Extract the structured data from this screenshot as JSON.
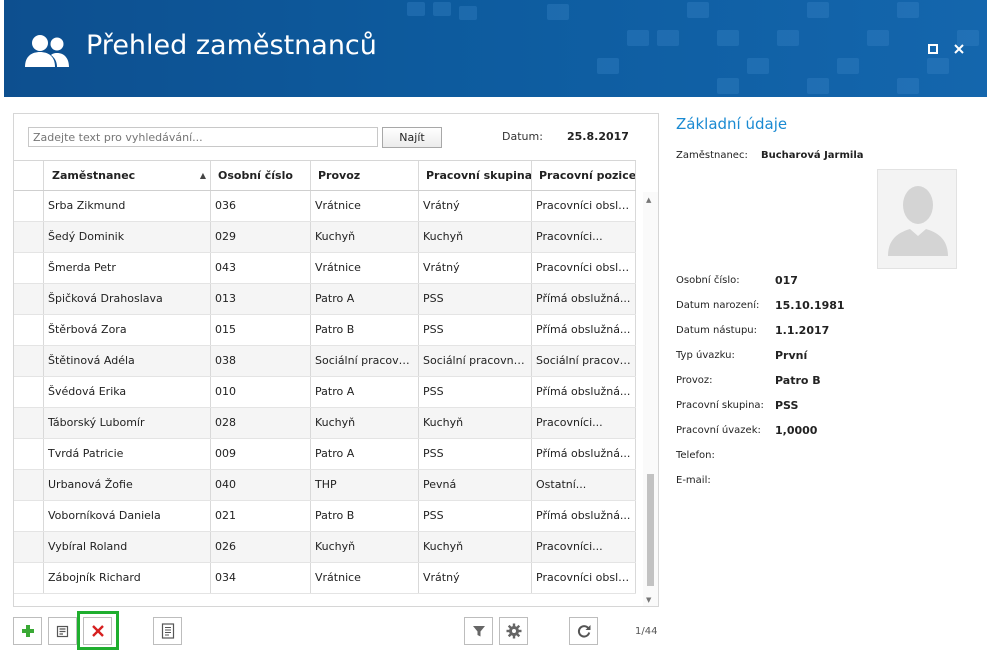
{
  "window": {
    "title": "Přehled zaměstnanců",
    "header_icon": "users-icon",
    "controls": [
      "maximize-icon",
      "close-icon"
    ]
  },
  "search": {
    "placeholder": "Zadejte text pro vyhledávání...",
    "value": "",
    "button_label": "Najít",
    "date_label": "Datum:",
    "date_value": "25.8.2017"
  },
  "grid": {
    "columns": [
      "Zaměstnanec",
      "Osobní číslo",
      "Provoz",
      "Pracovní skupina",
      "Pracovní pozice"
    ],
    "sorted_column": "Zaměstnanec",
    "sort_direction": "ascending",
    "rows": [
      [
        "Srba Zikmund",
        "036",
        "Vrátnice",
        "Vrátný",
        "Pracovníci obsluž..."
      ],
      [
        "Šedý Dominik",
        "029",
        "Kuchyň",
        "Kuchyň",
        "Pracovníci..."
      ],
      [
        "Šmerda Petr",
        "043",
        "Vrátnice",
        "Vrátný",
        "Pracovníci obsluž..."
      ],
      [
        "Špičková Drahoslava",
        "013",
        "Patro A",
        "PSS",
        "Přímá obslužná..."
      ],
      [
        "Štěrbová Zora",
        "015",
        "Patro B",
        "PSS",
        "Přímá obslužná..."
      ],
      [
        "Štětinová Adéla",
        "038",
        "Sociální pracovníci",
        "Sociální pracovnice ...",
        "Sociální pracovníci"
      ],
      [
        "Švédová Erika",
        "010",
        "Patro A",
        "PSS",
        "Přímá obslužná..."
      ],
      [
        "Táborský Lubomír",
        "028",
        "Kuchyň",
        "Kuchyň",
        "Pracovníci..."
      ],
      [
        "Tvrdá Patricie",
        "009",
        "Patro A",
        "PSS",
        "Přímá obslužná..."
      ],
      [
        "Urbanová Žofie",
        "040",
        "THP",
        "Pevná",
        "Ostatní..."
      ],
      [
        "Voborníková Daniela",
        "021",
        "Patro B",
        "PSS",
        "Přímá obslužná..."
      ],
      [
        "Vybíral Roland",
        "026",
        "Kuchyň",
        "Kuchyň",
        "Pracovníci..."
      ],
      [
        "Zábojník Richard",
        "034",
        "Vrátnice",
        "Vrátný",
        "Pracovníci obsluž..."
      ]
    ]
  },
  "toolbar": {
    "buttons": [
      "add-icon",
      "edit-icon",
      "delete-icon",
      "report-icon",
      "filter-icon",
      "settings-icon",
      "refresh-icon"
    ],
    "pager": "1/44",
    "colors": {
      "add": "#3aa935",
      "delete": "#d62020",
      "highlight": "#1fae2e"
    }
  },
  "detail": {
    "title": "Základní údaje",
    "employee_label": "Zaměstnanec:",
    "employee_value": "Bucharová Jarmila",
    "fields": [
      {
        "label": "Osobní číslo:",
        "value": "017"
      },
      {
        "label": "Datum narození:",
        "value": "15.10.1981"
      },
      {
        "label": "Datum nástupu:",
        "value": "1.1.2017"
      },
      {
        "label": "Typ úvazku:",
        "value": "První"
      },
      {
        "label": "Provoz:",
        "value": "Patro B"
      },
      {
        "label": "Pracovní skupina:",
        "value": "PSS"
      },
      {
        "label": "Pracovní úvazek:",
        "value": "1,0000"
      },
      {
        "label": "Telefon:",
        "value": ""
      },
      {
        "label": "E-mail:",
        "value": ""
      }
    ]
  },
  "colors": {
    "header_bg": "#0d5b9e",
    "accent": "#1a8ad2"
  }
}
